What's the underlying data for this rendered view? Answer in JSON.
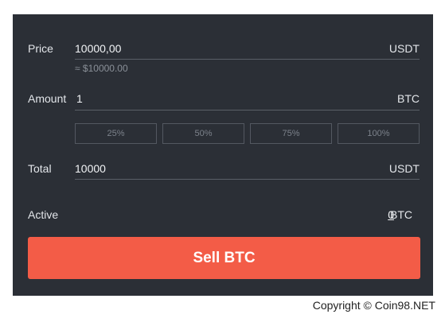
{
  "form": {
    "price": {
      "label": "Price",
      "value": "10000,00",
      "unit": "USDT",
      "hint": "≈ $10000.00"
    },
    "amount": {
      "label": "Amount",
      "value": "1",
      "unit": "BTC"
    },
    "percent_buttons": [
      "25%",
      "50%",
      "75%",
      "100%"
    ],
    "total": {
      "label": "Total",
      "value": "10000",
      "unit": "USDT"
    },
    "active": {
      "label": "Active",
      "amount": "0",
      "unit": "BTC"
    },
    "submit_label": "Sell BTC"
  },
  "footer": {
    "copyright": "Copyright © Coin98.NET"
  },
  "colors": {
    "panel_background": "#2b2f36",
    "sell_button": "#f35c47"
  }
}
